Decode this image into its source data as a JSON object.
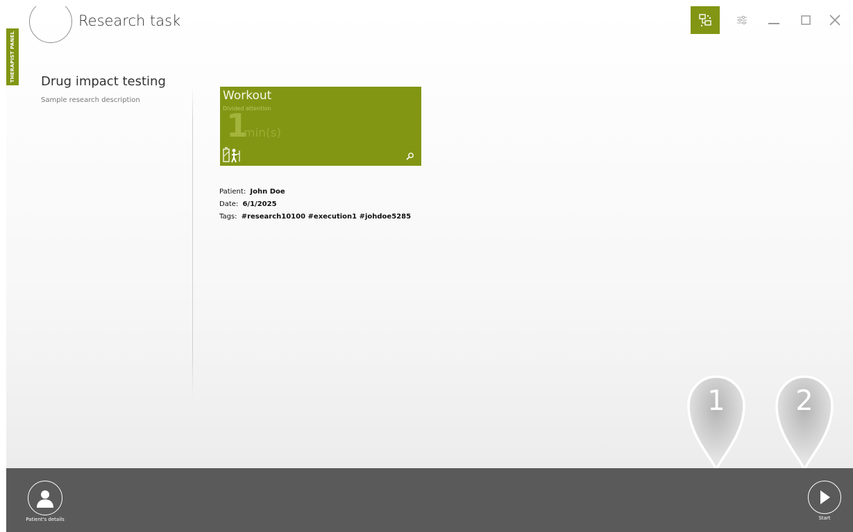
{
  "sidebar_tab": {
    "label": "THERAPIST PANEL"
  },
  "header": {
    "title": "Research task"
  },
  "research": {
    "name": "Drug impact testing",
    "description": "Sample research description"
  },
  "tile": {
    "title": "Workout",
    "subtitle": "Divided attention",
    "duration_value": "1",
    "duration_unit": "min(s)"
  },
  "details": {
    "patient_label": "Patient:",
    "patient_value": "John Doe",
    "date_label": "Date:",
    "date_value": "6/1/2025",
    "tags_label": "Tags:",
    "tags_value": "#research10100 #execution1 #johdoe5285"
  },
  "markers": [
    {
      "number": "1"
    },
    {
      "number": "2"
    }
  ],
  "bottom_bar": {
    "patient_details_label": "Patient's details",
    "start_label": "Start"
  },
  "colors": {
    "accent": "#829614",
    "bottom_bar": "#5a5a5a"
  },
  "icons": {
    "back": "arrow-left-icon",
    "network": "network-icon",
    "settings": "sliders-icon",
    "minimize": "minimize-icon",
    "maximize": "maximize-icon",
    "close": "close-icon",
    "tile_person": "person-station-icon",
    "tile_zoom": "magnifier-icon",
    "patient": "person-icon",
    "start": "play-icon"
  }
}
